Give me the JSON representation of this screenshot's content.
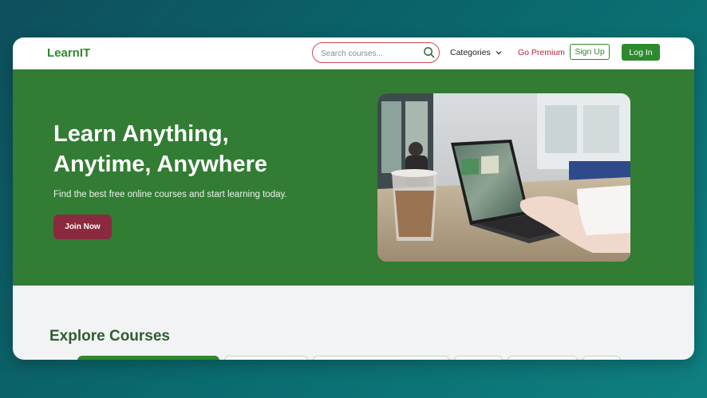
{
  "nav": {
    "logo": "LearnIT",
    "search_placeholder": "Search courses...",
    "categories_label": "Categories",
    "premium_label": "Go Premium",
    "signup_label": "Sign Up",
    "login_label": "Log In"
  },
  "hero": {
    "title_line1": "Learn Anything,",
    "title_line2": "Anytime, Anywhere",
    "subtitle": "Find the best free online courses and start learning today.",
    "cta_label": "Join Now"
  },
  "explore": {
    "heading": "Explore Courses"
  },
  "colors": {
    "brand_green": "#2e8a2e",
    "hero_bg": "#327c34",
    "accent_red": "#b8213e",
    "cta_bg": "#8b2a3f"
  }
}
